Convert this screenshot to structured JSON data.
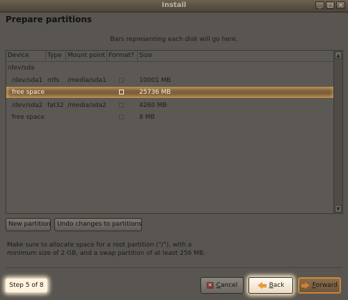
{
  "window": {
    "title": "Install",
    "controls": [
      "_",
      "□",
      "×"
    ]
  },
  "page": {
    "title": "Prepare partitions",
    "bars_message": "Bars representing each disk will go here."
  },
  "table": {
    "headers": {
      "device": "Device",
      "type": "Type",
      "mount": "Mount point",
      "format": "Format?",
      "size": "Size"
    },
    "disk": "/dev/sda",
    "rows": [
      {
        "device": "/dev/sda1",
        "type": "ntfs",
        "mount": "/media/sda1",
        "format": false,
        "size": "10001 MB",
        "selected": false
      },
      {
        "device": "free space",
        "type": "",
        "mount": "",
        "format": false,
        "size": "25736 MB",
        "selected": true
      },
      {
        "device": "/dev/sda2",
        "type": "fat32",
        "mount": "/media/sda2",
        "format": false,
        "size": "4260 MB",
        "selected": false
      },
      {
        "device": "free space",
        "type": "",
        "mount": "",
        "format": false,
        "size": "8 MB",
        "selected": false
      }
    ]
  },
  "buttons": {
    "new_partition": "New partition",
    "undo": "Undo changes to partitions",
    "cancel_prefix": "",
    "cancel_mnemonic": "C",
    "cancel_rest": "ancel",
    "back_mnemonic": "B",
    "back_rest": "ack",
    "forward_mnemonic": "F",
    "forward_rest": "orward"
  },
  "hint": "Make sure to allocate space for a root partition (\"/\"), with a minimum size of 2 GB, and a swap partition of at least 256 MB.",
  "step": "Step 5 of 8",
  "icons": {
    "cancel": "cancel-icon",
    "back": "arrow-left-icon",
    "forward": "arrow-right-icon"
  },
  "colors": {
    "accent": "#e79b3f",
    "selection": "#ffd68c"
  }
}
